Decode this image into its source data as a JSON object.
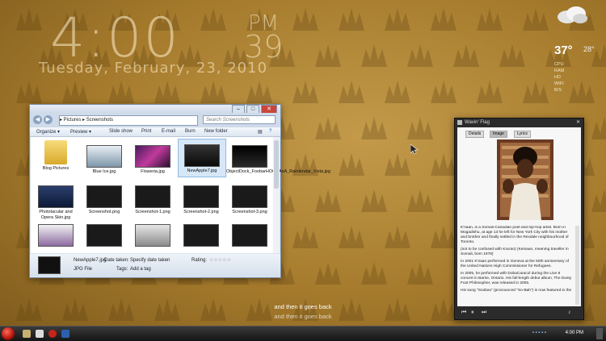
{
  "clock": {
    "time": "4:00",
    "ampm": "PM",
    "seconds": "39",
    "date": "Tuesday, February, 23, 2010"
  },
  "weather": {
    "temp": "37°",
    "low": "28°",
    "stats": [
      "CPU",
      "RAM",
      "HD",
      "WIFI",
      "B/S"
    ]
  },
  "explorer": {
    "breadcrumb": "▸ Pictures ▸ Screenshots",
    "search_placeholder": "Search Screenshots",
    "toolbar": {
      "organize": "Organize ▾",
      "preview": "Preview ▾",
      "slideshow": "Slide show",
      "print": "Print",
      "email": "E-mail",
      "burn": "Burn",
      "newfolder": "New folder"
    },
    "items": [
      {
        "label": "Blog Pictures"
      },
      {
        "label": "Blue Ice.jpg"
      },
      {
        "label": "Floweria.jpg"
      },
      {
        "label": "NewApple7.jpg"
      },
      {
        "label": "ObjectDock_FoobarHOOAAxA_Rainlendar_Vista.jpg"
      },
      {
        "label": "Photolacular and Opera Skin.jpg"
      },
      {
        "label": "Screenshot.png"
      },
      {
        "label": "Screenshot-1.png"
      },
      {
        "label": "Screenshot-2.png"
      },
      {
        "label": "Screenshot-3.png"
      },
      {
        "label": ""
      },
      {
        "label": ""
      },
      {
        "label": ""
      },
      {
        "label": ""
      },
      {
        "label": ""
      }
    ],
    "details": {
      "name": "NewApple7.jpg",
      "type": "JPG File",
      "date_label": "Date taken:",
      "date_value": "Specify date taken",
      "tags_label": "Tags:",
      "tags_value": "Add a tag",
      "rating_label": "Rating:",
      "stars": "☆☆☆☆☆"
    }
  },
  "gadget": {
    "title": "Wavin' Flag",
    "tabs": [
      "Details",
      "Image",
      "Lyrics"
    ],
    "bio": [
      "K'naan, is a Somali-Canadian poet and hip-hop artist. Born in Mogadishu, at age 13 he left for New York City with his mother and brother and finally settled in the Rexdale neighbourhood of Toronto.",
      "(not to be confused with Kna'an) (Keinaan, meaning traveller in Somali, born 1978)",
      "In 2001 K'naan performed in Geneva at the 50th anniversary of the United Nations High Commissioner for Refugees.",
      "In 2005, he performed with DobaCaracol during the Live 8 concert in Barrie, Ontario. His full-length debut album, The Dusty Foot Philosopher, was released in 2005.",
      "His song \"Soobax\" (pronounced \"So-Bah\") is now featured in the"
    ]
  },
  "lyrics": {
    "line1": "and then it goes back",
    "line2": "and then it goes back"
  },
  "taskbar": {
    "time": "4:00 PM"
  }
}
